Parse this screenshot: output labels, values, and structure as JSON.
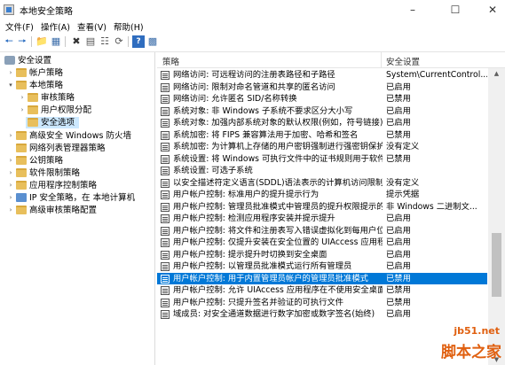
{
  "window": {
    "title": "本地安全策略"
  },
  "menu": [
    "文件(F)",
    "操作(A)",
    "查看(V)",
    "帮助(H)"
  ],
  "tree": [
    {
      "label": "安全设置",
      "expander": "▾",
      "icon": "shield-icon"
    },
    {
      "label": "帐户策略",
      "expander": "›",
      "icon": "folder-icon"
    },
    {
      "label": "本地策略",
      "expander": "▾",
      "icon": "folder-icon"
    },
    {
      "label": "审核策略",
      "expander": "›",
      "icon": "folder-icon"
    },
    {
      "label": "用户权限分配",
      "expander": "›",
      "icon": "folder-icon"
    },
    {
      "label": "安全选项",
      "expander": "",
      "icon": "folder-icon"
    },
    {
      "label": "高级安全 Windows 防火墙",
      "expander": "›",
      "icon": "folder-icon"
    },
    {
      "label": "网络列表管理器策略",
      "expander": "",
      "icon": "folder-icon"
    },
    {
      "label": "公钥策略",
      "expander": "›",
      "icon": "folder-icon"
    },
    {
      "label": "软件限制策略",
      "expander": "›",
      "icon": "folder-icon"
    },
    {
      "label": "应用程序控制策略",
      "expander": "›",
      "icon": "folder-icon"
    },
    {
      "label": "IP 安全策略，在 本地计算机",
      "expander": "›",
      "icon": "computer-icon"
    },
    {
      "label": "高级审核策略配置",
      "expander": "›",
      "icon": "folder-icon"
    }
  ],
  "columns": {
    "policy": "策略",
    "setting": "安全设置"
  },
  "policies": [
    {
      "name": "网络访问: 可远程访问的注册表路径和子路径",
      "setting": "System\\CurrentControl..."
    },
    {
      "name": "网络访问: 限制对命名管道和共享的匿名访问",
      "setting": "已启用"
    },
    {
      "name": "网络访问: 允许匿名 SID/名称转换",
      "setting": "已禁用"
    },
    {
      "name": "系统对象: 非 Windows 子系统不要求区分大小写",
      "setting": "已启用"
    },
    {
      "name": "系统对象: 加强内部系统对象的默认权限(例如，符号链接)",
      "setting": "已启用"
    },
    {
      "name": "系统加密: 将 FIPS 兼容算法用于加密、哈希和签名",
      "setting": "已禁用"
    },
    {
      "name": "系统加密: 为计算机上存储的用户密钥强制进行强密钥保护",
      "setting": "没有定义"
    },
    {
      "name": "系统设置: 将 Windows 可执行文件中的证书规则用于软件...",
      "setting": "已禁用"
    },
    {
      "name": "系统设置: 可选子系统",
      "setting": ""
    },
    {
      "name": "以安全描述符定义语言(SDDL)语法表示的计算机访问限制",
      "setting": "没有定义"
    },
    {
      "name": "用户帐户控制: 标准用户的提升提示行为",
      "setting": "提示凭据"
    },
    {
      "name": "用户帐户控制: 管理员批准模式中管理员的提升权限提示的...",
      "setting": "非 Windows 二进制文..."
    },
    {
      "name": "用户帐户控制: 检测应用程序安装并提示提升",
      "setting": "已启用"
    },
    {
      "name": "用户帐户控制: 将文件和注册表写入错误虚拟化到每用户位置",
      "setting": "已启用"
    },
    {
      "name": "用户帐户控制: 仅提升安装在安全位置的 UIAccess 应用程序",
      "setting": "已启用"
    },
    {
      "name": "用户帐户控制: 提示提升时切换到安全桌面",
      "setting": "已启用"
    },
    {
      "name": "用户帐户控制: 以管理员批准模式运行所有管理员",
      "setting": "已启用"
    },
    {
      "name": "用户帐户控制: 用于内置管理员帐户的管理员批准模式",
      "setting": "已禁用"
    },
    {
      "name": "用户帐户控制: 允许 UIAccess 应用程序在不使用安全桌面...",
      "setting": "已禁用"
    },
    {
      "name": "用户帐户控制: 只提升签名并验证的可执行文件",
      "setting": "已禁用"
    },
    {
      "name": "域成员: 对安全通道数据进行数字加密或数字签名(始终)",
      "setting": "已启用"
    }
  ],
  "selected_policy_index": 17,
  "watermark": {
    "site": "jb51.net",
    "brand": "脚本之家"
  },
  "colors": {
    "selection": "#0078d7",
    "tree_selection": "#cce8ff",
    "watermark": "#e06010"
  }
}
